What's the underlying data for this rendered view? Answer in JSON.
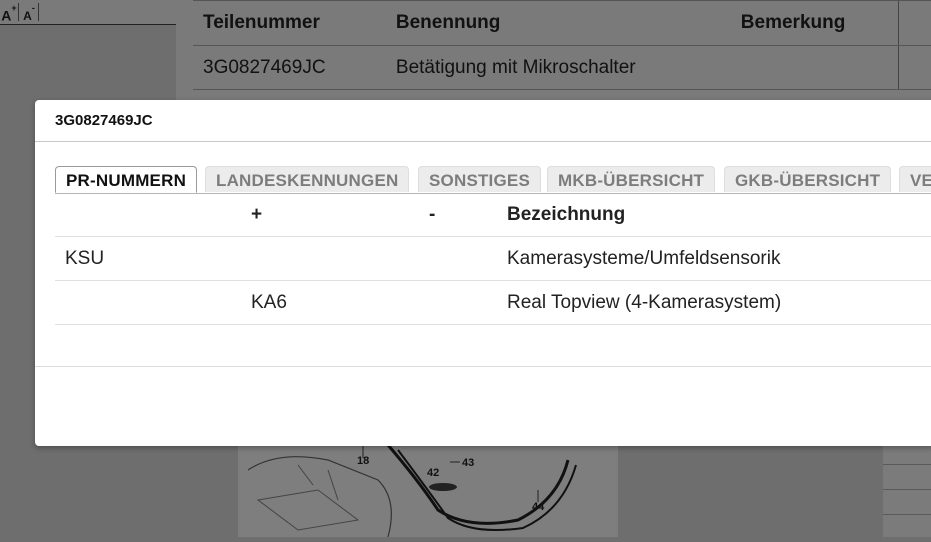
{
  "toolbar": {
    "font_increase": "A",
    "font_increase_sup": "+",
    "font_decrease": "A",
    "font_decrease_sup": "-"
  },
  "parts_table": {
    "headers": [
      "Teilenummer",
      "Benennung",
      "Bemerkung"
    ],
    "rows": [
      {
        "nr": "3G0827469JC",
        "name": "Betätigung mit Mikroschalter",
        "remark": ""
      }
    ]
  },
  "diagram": {
    "labels": [
      "18",
      "42",
      "43",
      "44"
    ]
  },
  "modal": {
    "title": "3G0827469JC",
    "tabs": [
      {
        "label": "PR-NUMMERN",
        "active": true
      },
      {
        "label": "LANDESKENNUNGEN",
        "active": false
      },
      {
        "label": "SONSTIGES",
        "active": false
      },
      {
        "label": "MKB-ÜBERSICHT",
        "active": false
      },
      {
        "label": "GKB-ÜBERSICHT",
        "active": false
      },
      {
        "label": "VE",
        "active": false
      }
    ],
    "table": {
      "headers": [
        "",
        "+",
        "-",
        "Bezeichnung"
      ],
      "rows": [
        {
          "code": "KSU",
          "plus": "",
          "minus": "",
          "desc": "Kamerasysteme/Umfeldsensorik"
        },
        {
          "code": "",
          "plus": "KA6",
          "minus": "",
          "desc": "Real Topview (4-Kamerasystem)"
        }
      ]
    }
  }
}
